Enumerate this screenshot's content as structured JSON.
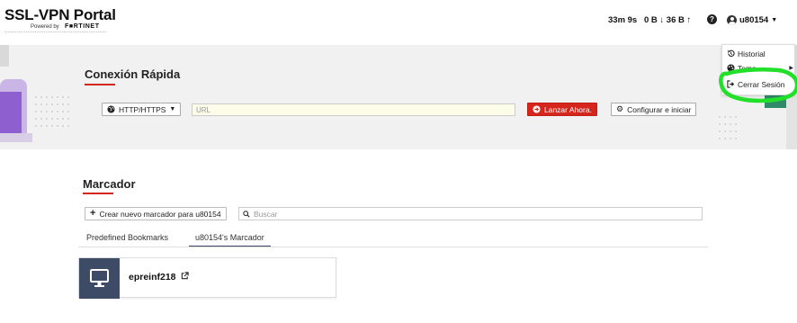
{
  "header": {
    "app_title": "SSL-VPN Portal",
    "powered_by": "Powered by",
    "brand": "F■RTINET",
    "session_time": "33m 9s",
    "traffic": "0 B ↓ 36 B ↑",
    "username": "u80154"
  },
  "user_menu": {
    "items": [
      {
        "label": "Historial",
        "icon": "history-icon"
      },
      {
        "label": "Tema",
        "icon": "palette-icon"
      },
      {
        "label": "Cerrar Sesión",
        "icon": "sign-out-icon"
      }
    ]
  },
  "quick_connect": {
    "title": "Conexión Rápida",
    "protocol": "HTTP/HTTPS",
    "url_placeholder": "URL",
    "launch_label": "Lanzar Ahora.",
    "configure_label": "Configurar e iniciar"
  },
  "bookmarks": {
    "title": "Marcador",
    "create_label": "Crear nuevo marcador para u80154",
    "search_placeholder": "Buscar",
    "tabs": [
      {
        "label": "Predefined Bookmarks",
        "active": false
      },
      {
        "label": "u80154's Marcador",
        "active": true
      }
    ],
    "items": [
      {
        "name": "epreinf218",
        "icon": "desktop-icon"
      }
    ]
  },
  "colors": {
    "accent_red": "#d5261e",
    "card_navy": "#3d4b67",
    "highlight_green": "#22e02a"
  }
}
